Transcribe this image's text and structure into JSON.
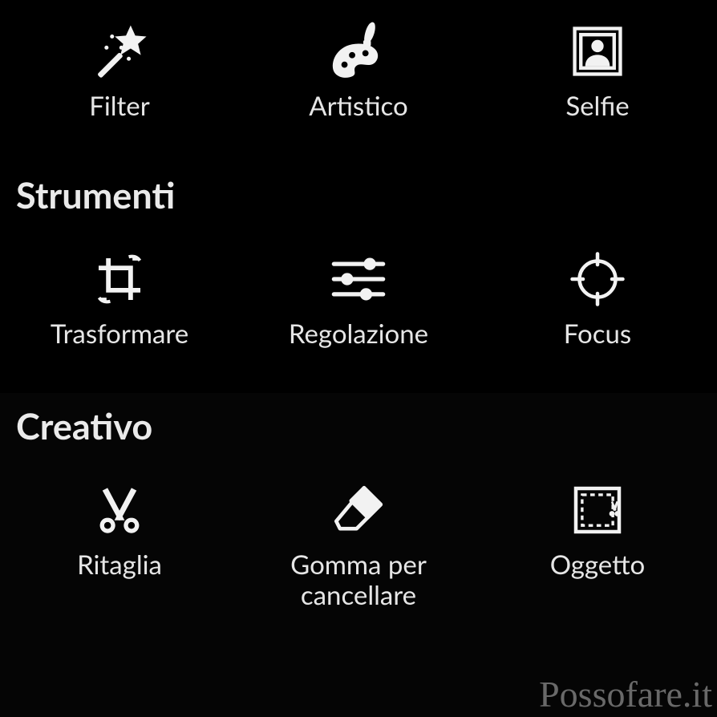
{
  "row1": {
    "filter": {
      "label": "Filter",
      "icon_name": "magic-wand-icon"
    },
    "artistic": {
      "label": "Artistico",
      "icon_name": "palette-icon"
    },
    "selfie": {
      "label": "Selfie",
      "icon_name": "portrait-icon"
    }
  },
  "tools": {
    "heading": "Strumenti",
    "transform": {
      "label": "Trasformare",
      "icon_name": "crop-icon"
    },
    "adjust": {
      "label": "Regolazione",
      "icon_name": "sliders-icon"
    },
    "focus": {
      "label": "Focus",
      "icon_name": "target-icon"
    }
  },
  "creative": {
    "heading": "Creativo",
    "cut": {
      "label": "Ritaglia",
      "icon_name": "scissors-icon"
    },
    "eraser": {
      "label": "Gomma per cancellare",
      "icon_name": "eraser-icon"
    },
    "object": {
      "label": "Oggetto",
      "icon_name": "selection-box-icon"
    }
  },
  "watermark": "Possofare.it",
  "colors": {
    "bg": "#000000",
    "fg": "#e8e8e8",
    "icon": "#f2f2f2",
    "watermark": "#6f6f6f"
  }
}
